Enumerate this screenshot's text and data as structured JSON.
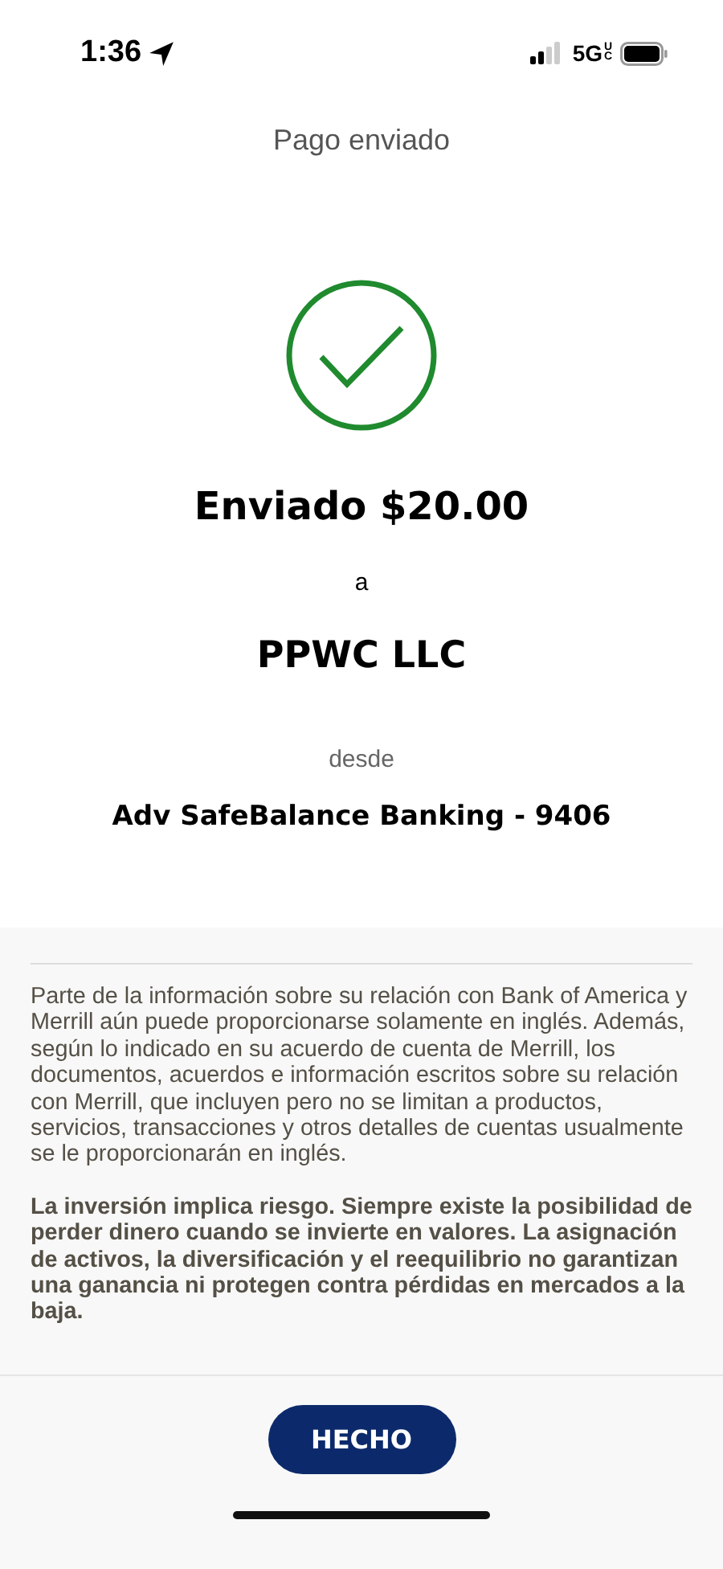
{
  "status_bar": {
    "time": "1:36",
    "network": "5G",
    "network_badge": "UC"
  },
  "header": {
    "title": "Pago enviado"
  },
  "confirmation": {
    "amount_line": "Enviado $20.00",
    "to_label": "a",
    "payee": "PPWC LLC",
    "from_label": "desde",
    "account": "Adv SafeBalance Banking - 9406"
  },
  "disclosures": [
    {
      "kind": "normal",
      "text": "Parte de la información sobre su relación con Bank of America y Merrill aún puede proporcionarse solamente en inglés. Además, según lo indicado en su acuerdo de cuenta de Merrill, los documentos, acuerdos e información escritos sobre su relación con Merrill, que incluyen pero no se limitan a productos, servicios, transacciones y otros detalles de cuentas usualmente se le proporcionarán en inglés."
    },
    {
      "kind": "bold",
      "text": "La inversión implica riesgo. Siempre existe la posibilidad de perder dinero cuando se invierte en valores. La asignación de activos, la diversificación y el reequilibrio no garantizan una ganancia ni protegen contra pérdidas en mercados a la baja."
    }
  ],
  "done_button": {
    "label": "HECHO"
  }
}
